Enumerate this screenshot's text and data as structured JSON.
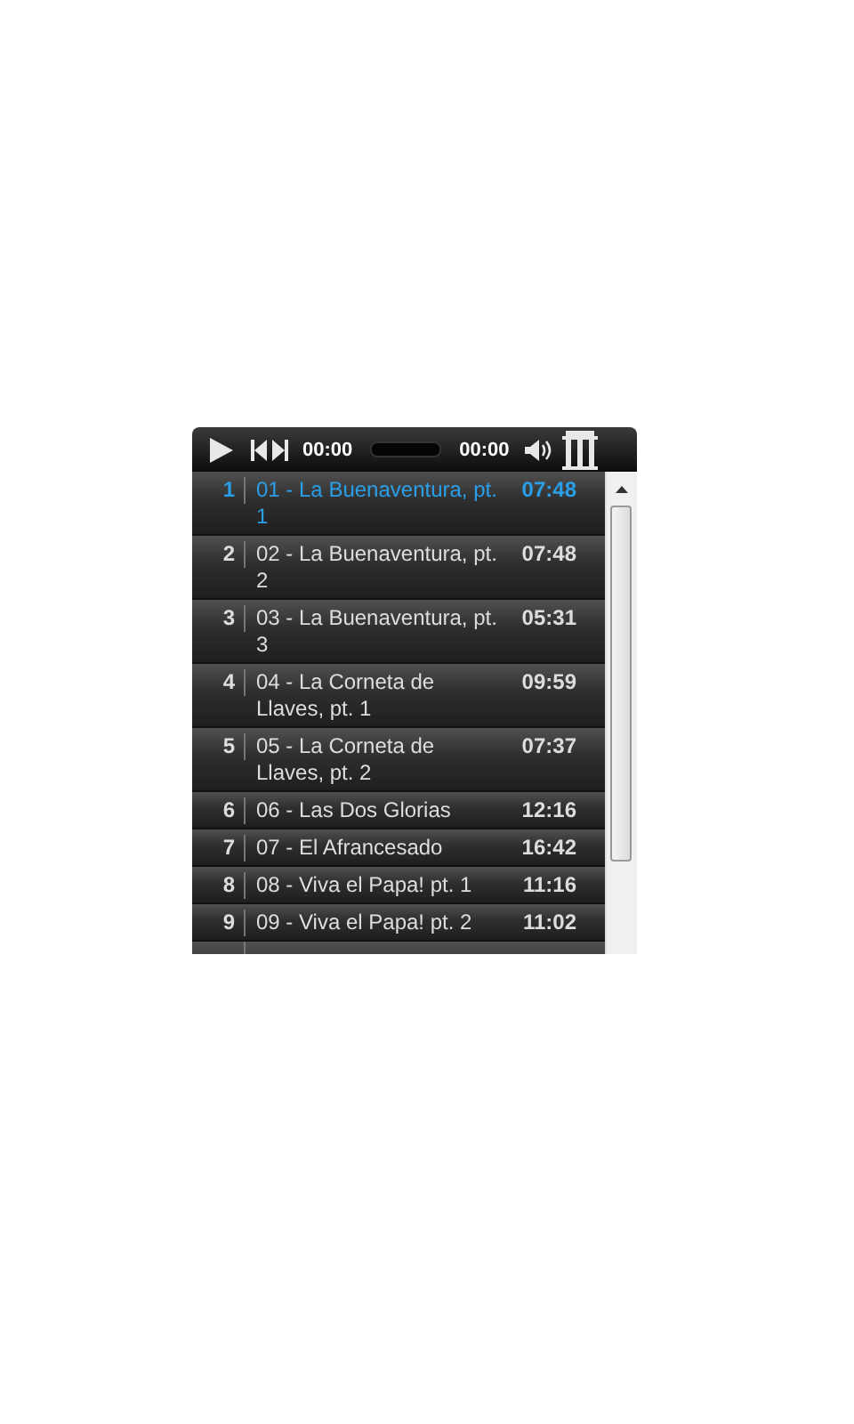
{
  "player": {
    "elapsed": "00:00",
    "duration": "00:00"
  },
  "tracks": [
    {
      "number": "1",
      "title": "01 - La Buenaventura, pt. 1",
      "time": "07:48",
      "selected": true
    },
    {
      "number": "2",
      "title": "02 - La Buenaventura, pt. 2",
      "time": "07:48",
      "selected": false
    },
    {
      "number": "3",
      "title": "03 - La Buenaventura, pt. 3",
      "time": "05:31",
      "selected": false
    },
    {
      "number": "4",
      "title": "04 - La Corneta de Llaves, pt. 1",
      "time": "09:59",
      "selected": false
    },
    {
      "number": "5",
      "title": "05 - La Corneta de Llaves, pt. 2",
      "time": "07:37",
      "selected": false
    },
    {
      "number": "6",
      "title": "06 - Las Dos Glorias",
      "time": "12:16",
      "selected": false
    },
    {
      "number": "7",
      "title": "07 - El Afrancesado",
      "time": "16:42",
      "selected": false
    },
    {
      "number": "8",
      "title": "08 - Viva el Papa! pt. 1",
      "time": "11:16",
      "selected": false
    },
    {
      "number": "9",
      "title": "09 - Viva el Papa! pt. 2",
      "time": "11:02",
      "selected": false
    }
  ]
}
